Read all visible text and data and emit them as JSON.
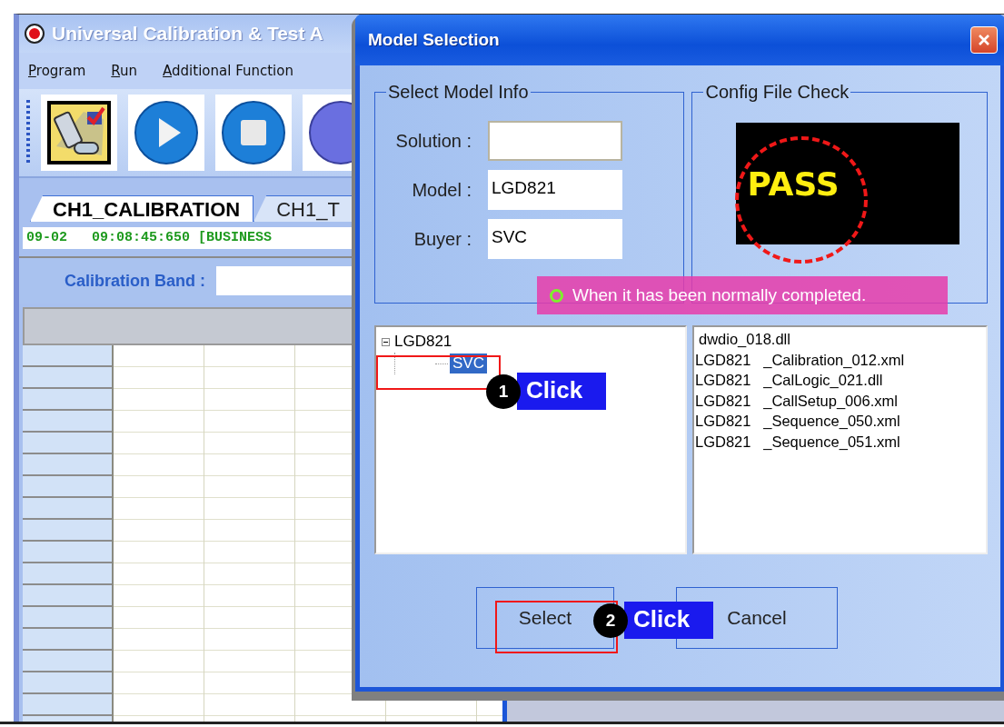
{
  "app_window": {
    "title": "Universal Calibration & Test A",
    "menu": [
      "Program",
      "Run",
      "Additional Function"
    ],
    "tabs": [
      {
        "label": "CH1_CALIBRATION",
        "selected": true
      },
      {
        "label": "CH1_T",
        "selected": false
      }
    ],
    "log_line": "09-02   09:08:45:650 [BUSINESS",
    "calibration_band_label": "Calibration Band :"
  },
  "dialog": {
    "title": "Model Selection",
    "model_info": {
      "legend": "Select Model Info",
      "fields": [
        {
          "label": "Solution :"
        },
        {
          "label": "Model :",
          "value": "LGD821"
        },
        {
          "label": "Buyer :",
          "value": "SVC"
        }
      ]
    },
    "config_check": {
      "legend": "Config File Check",
      "result": "PASS"
    },
    "tree": [
      {
        "label": "LGD821",
        "expanded": true,
        "selected": false,
        "children": [
          {
            "label": "SVC",
            "selected": true
          }
        ]
      }
    ],
    "files": [
      "dwdio_018.dll",
      "LGD821   _Calibration_012.xml",
      "LGD821   _CalLogic_021.dll",
      "LGD821   _CallSetup_006.xml",
      "LGD821   _Sequence_050.xml",
      "LGD821   _Sequence_051.xml"
    ],
    "buttons": [
      {
        "label": "Select"
      },
      {
        "label": "Cancel"
      }
    ]
  },
  "note": "When it has been normally completed.",
  "annotations": [
    {
      "number": "1",
      "label": "Click"
    },
    {
      "number": "2",
      "label": "Click"
    }
  ]
}
